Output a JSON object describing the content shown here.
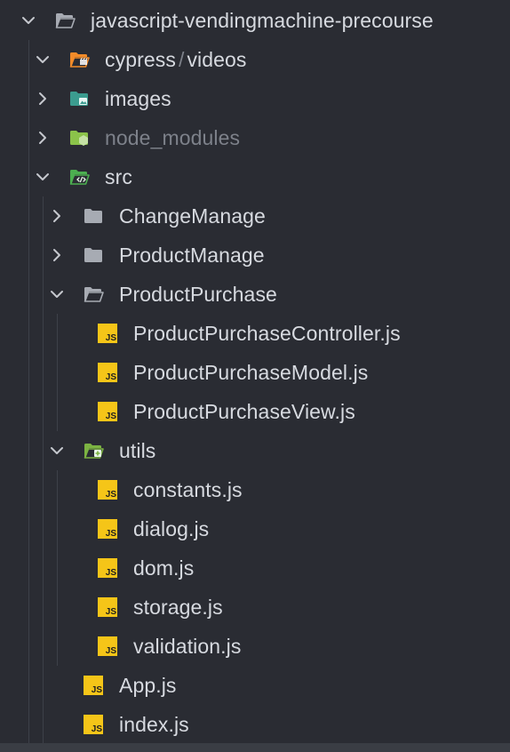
{
  "explorer": {
    "items": [
      {
        "label": "javascript-vendingmachine-precourse",
        "kind": "folder-open",
        "level": 0,
        "expanded": true,
        "icon": "folder-open-icon",
        "color": "#a7abb3"
      },
      {
        "label": "cypress",
        "label_suffix": "videos",
        "separator": "/",
        "kind": "folder-open",
        "level": 1,
        "expanded": true,
        "icon": "folder-cypress-icon",
        "color": "#f28b29"
      },
      {
        "label": "images",
        "kind": "folder",
        "level": 1,
        "expanded": false,
        "icon": "folder-images-icon",
        "color": "#3b9c8f"
      },
      {
        "label": "node_modules",
        "kind": "folder",
        "level": 1,
        "expanded": false,
        "icon": "folder-node-icon",
        "color": "#8bc34a",
        "dim": true
      },
      {
        "label": "src",
        "kind": "folder-open",
        "level": 1,
        "expanded": true,
        "icon": "folder-src-icon",
        "color": "#4caf50"
      },
      {
        "label": "ChangeManage",
        "kind": "folder",
        "level": 2,
        "expanded": false,
        "icon": "folder-icon",
        "color": "#a7abb3"
      },
      {
        "label": "ProductManage",
        "kind": "folder",
        "level": 2,
        "expanded": false,
        "icon": "folder-icon",
        "color": "#a7abb3"
      },
      {
        "label": "ProductPurchase",
        "kind": "folder-open",
        "level": 2,
        "expanded": true,
        "icon": "folder-open-icon",
        "color": "#a7abb3"
      },
      {
        "label": "ProductPurchaseController.js",
        "kind": "file",
        "level": 3,
        "icon": "js-file-icon"
      },
      {
        "label": "ProductPurchaseModel.js",
        "kind": "file",
        "level": 3,
        "icon": "js-file-icon"
      },
      {
        "label": "ProductPurchaseView.js",
        "kind": "file",
        "level": 3,
        "icon": "js-file-icon"
      },
      {
        "label": "utils",
        "kind": "folder-open",
        "level": 2,
        "expanded": true,
        "icon": "folder-utils-icon",
        "color": "#7cb342"
      },
      {
        "label": "constants.js",
        "kind": "file",
        "level": 3,
        "icon": "js-file-icon"
      },
      {
        "label": "dialog.js",
        "kind": "file",
        "level": 3,
        "icon": "js-file-icon"
      },
      {
        "label": "dom.js",
        "kind": "file",
        "level": 3,
        "icon": "js-file-icon"
      },
      {
        "label": "storage.js",
        "kind": "file",
        "level": 3,
        "icon": "js-file-icon"
      },
      {
        "label": "validation.js",
        "kind": "file",
        "level": 3,
        "icon": "js-file-icon"
      },
      {
        "label": "App.js",
        "kind": "file",
        "level": 2,
        "icon": "js-file-icon"
      },
      {
        "label": "index.js",
        "kind": "file",
        "level": 2,
        "icon": "js-file-icon"
      }
    ],
    "js_badge": "JS",
    "colors": {
      "background": "#2a2c33",
      "text": "#d7dae0",
      "dim_text": "#7d818a",
      "js_yellow": "#f5c518",
      "chevron": "#c5c8ce"
    }
  }
}
